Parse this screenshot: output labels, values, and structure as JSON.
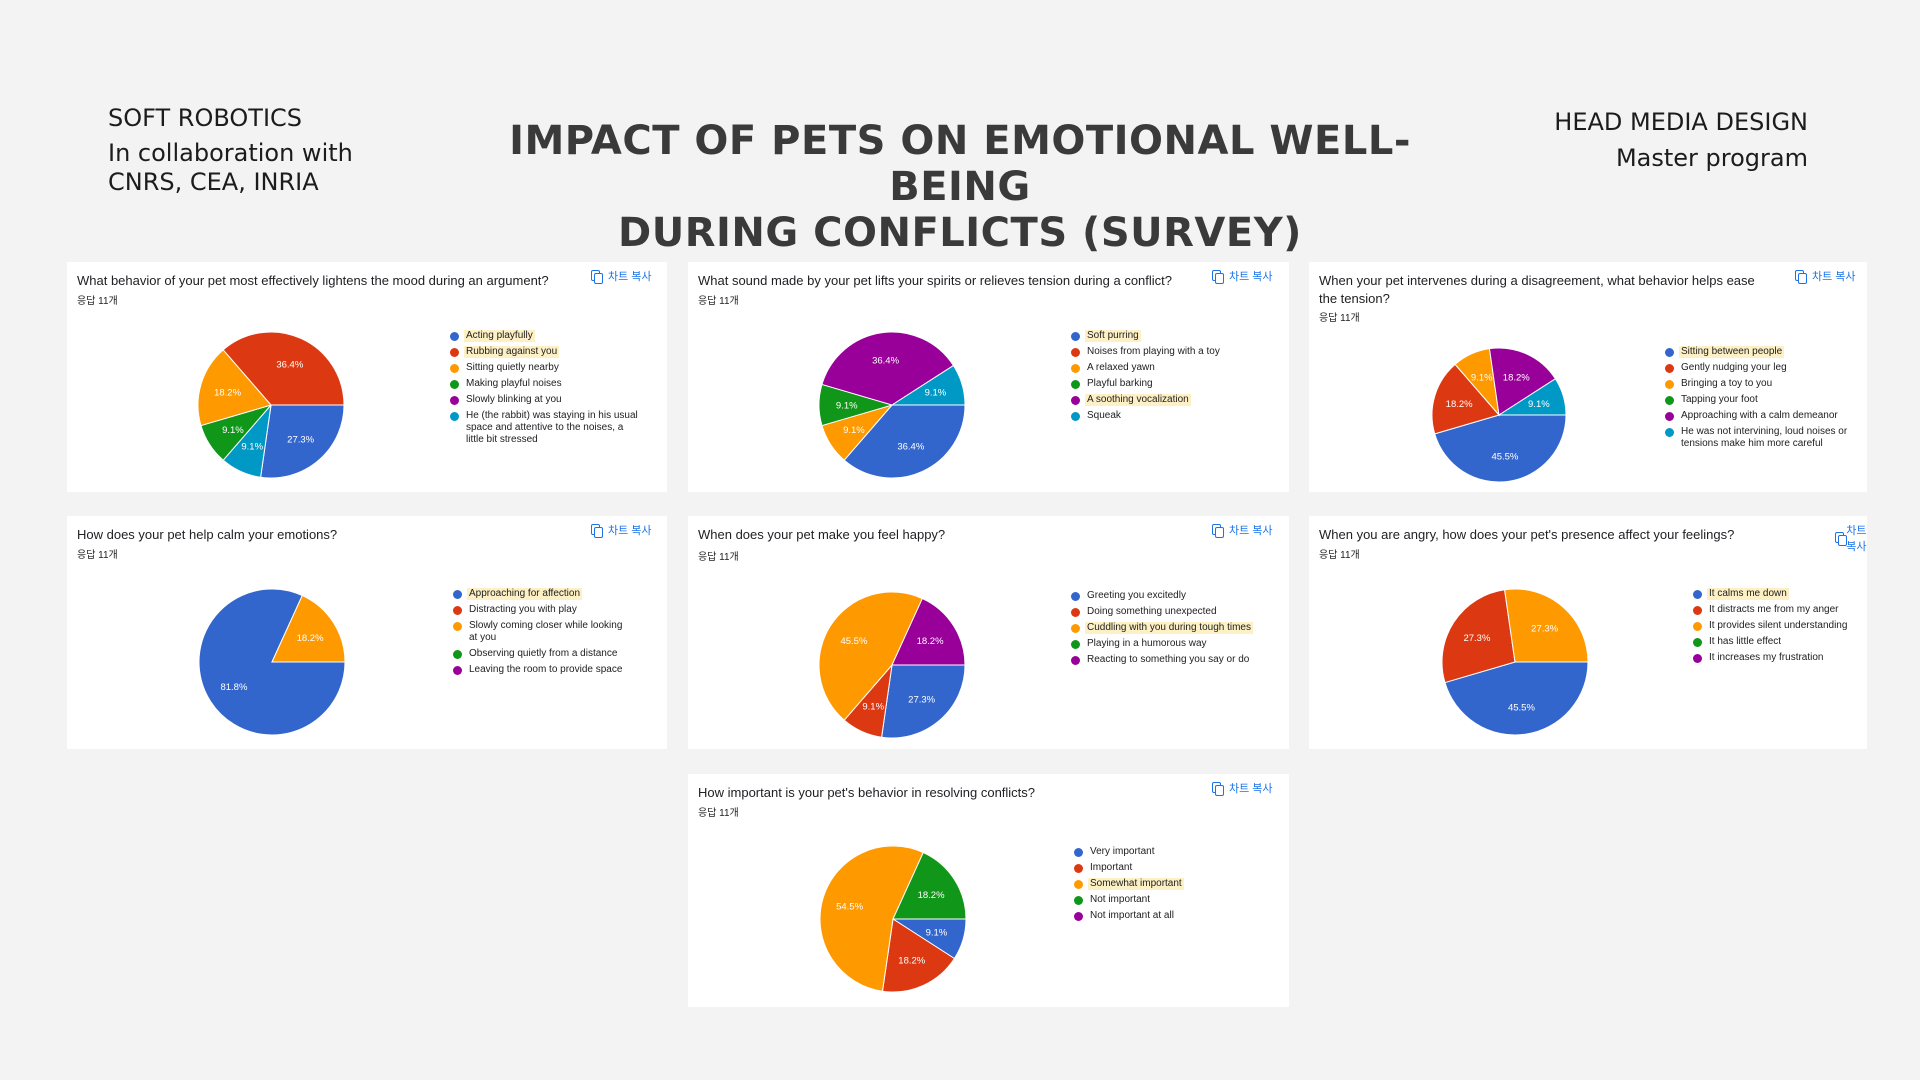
{
  "header": {
    "left_line1": "SOFT ROBOTICS",
    "left_line2": "In collaboration with",
    "left_line3": "CNRS, CEA, INRIA",
    "title_line1": "IMPACT OF PETS ON EMOTIONAL WELL-BEING",
    "title_line2": "DURING CONFLICTS (SURVEY)",
    "right_line1": "HEAD MEDIA DESIGN",
    "right_line2": "Master program"
  },
  "copy_label": "차트 복사",
  "colors": {
    "blue": "#3366cc",
    "red": "#dc3912",
    "orange": "#ff9900",
    "green": "#109618",
    "purple": "#990099",
    "teal": "#0099c6",
    "highlight": "#fdf0c4"
  },
  "chart_data": [
    {
      "type": "pie",
      "title": "What behavior of your pet most effectively lightens the mood during an argument?",
      "responses": "응답 11개",
      "labels": [
        "Acting playfully",
        "Rubbing against you",
        "Sitting quietly nearby",
        "Making playful noises",
        "Slowly blinking at you",
        "He (the rabbit) was staying in his usual space and attentive to the noises, a little bit stressed"
      ],
      "colors": [
        "#3366cc",
        "#dc3912",
        "#ff9900",
        "#109618",
        "#990099",
        "#0099c6"
      ],
      "highlighted": [
        0,
        1
      ],
      "values": [
        27.3,
        36.4,
        18.2,
        9.1,
        0,
        9.1
      ],
      "order": [
        0,
        5,
        3,
        2,
        1
      ]
    },
    {
      "type": "pie",
      "title": "What sound made by your pet lifts your spirits or relieves tension during a conflict?",
      "responses": "응답 11개",
      "labels": [
        "Soft purring",
        "Noises from playing with a toy",
        "A relaxed yawn",
        "Playful barking",
        "A soothing vocalization",
        "Squeak"
      ],
      "colors": [
        "#3366cc",
        "#dc3912",
        "#ff9900",
        "#109618",
        "#990099",
        "#0099c6"
      ],
      "highlighted": [
        0,
        4
      ],
      "values": [
        36.4,
        0,
        9.1,
        9.1,
        36.4,
        9.1
      ],
      "order": [
        0,
        2,
        3,
        4,
        5
      ]
    },
    {
      "type": "pie",
      "title": "When your pet intervenes during a disagreement, what behavior helps ease the tension?",
      "responses": "응답 11개",
      "labels": [
        "Sitting between people",
        "Gently nudging your leg",
        "Bringing a toy to you",
        "Tapping your foot",
        "Approaching with a calm demeanor",
        "He was not intervining, loud noises or tensions make him more careful"
      ],
      "colors": [
        "#3366cc",
        "#dc3912",
        "#ff9900",
        "#109618",
        "#990099",
        "#0099c6"
      ],
      "highlighted": [
        0
      ],
      "values": [
        45.5,
        18.2,
        9.1,
        0,
        18.2,
        9.1
      ],
      "order": [
        0,
        1,
        2,
        4,
        5
      ]
    },
    {
      "type": "pie",
      "title": "How does your pet help calm your emotions?",
      "responses": "응답 11개",
      "labels": [
        "Approaching for affection",
        "Distracting you with play",
        "Slowly coming closer while looking at you",
        "Observing quietly from a distance",
        "Leaving the room to provide space"
      ],
      "colors": [
        "#3366cc",
        "#dc3912",
        "#ff9900",
        "#109618",
        "#990099"
      ],
      "highlighted": [
        0
      ],
      "values": [
        81.8,
        0,
        18.2,
        0,
        0
      ],
      "order": [
        0,
        2
      ]
    },
    {
      "type": "pie",
      "title": "When does your pet make you feel happy?",
      "responses": "응답 11개",
      "labels": [
        "Greeting you excitedly",
        "Doing something unexpected",
        "Cuddling with you during tough times",
        "Playing in a humorous way",
        "Reacting to something you say or do"
      ],
      "colors": [
        "#3366cc",
        "#dc3912",
        "#ff9900",
        "#109618",
        "#990099"
      ],
      "highlighted": [
        2
      ],
      "values": [
        27.3,
        9.1,
        45.5,
        0,
        18.2
      ],
      "order": [
        0,
        1,
        2,
        4
      ]
    },
    {
      "type": "pie",
      "title": "When you are angry, how does your pet's presence affect your feelings?",
      "responses": "응답 11개",
      "labels": [
        "It calms me down",
        "It distracts me from my anger",
        "It provides silent understanding",
        "It has little effect",
        "It increases my frustration"
      ],
      "colors": [
        "#3366cc",
        "#dc3912",
        "#ff9900",
        "#109618",
        "#990099"
      ],
      "highlighted": [
        0
      ],
      "values": [
        45.5,
        27.3,
        27.3,
        0,
        0
      ],
      "order": [
        0,
        1,
        2
      ]
    },
    {
      "type": "pie",
      "title": "How important is your pet's behavior in resolving conflicts?",
      "responses": "응답 11개",
      "labels": [
        "Very important",
        "Important",
        "Somewhat important",
        "Not important",
        "Not important at all"
      ],
      "colors": [
        "#3366cc",
        "#dc3912",
        "#ff9900",
        "#109618",
        "#990099"
      ],
      "highlighted": [
        2
      ],
      "values": [
        9.1,
        18.2,
        54.5,
        18.2,
        0
      ],
      "order": [
        0,
        1,
        2,
        3
      ]
    }
  ]
}
